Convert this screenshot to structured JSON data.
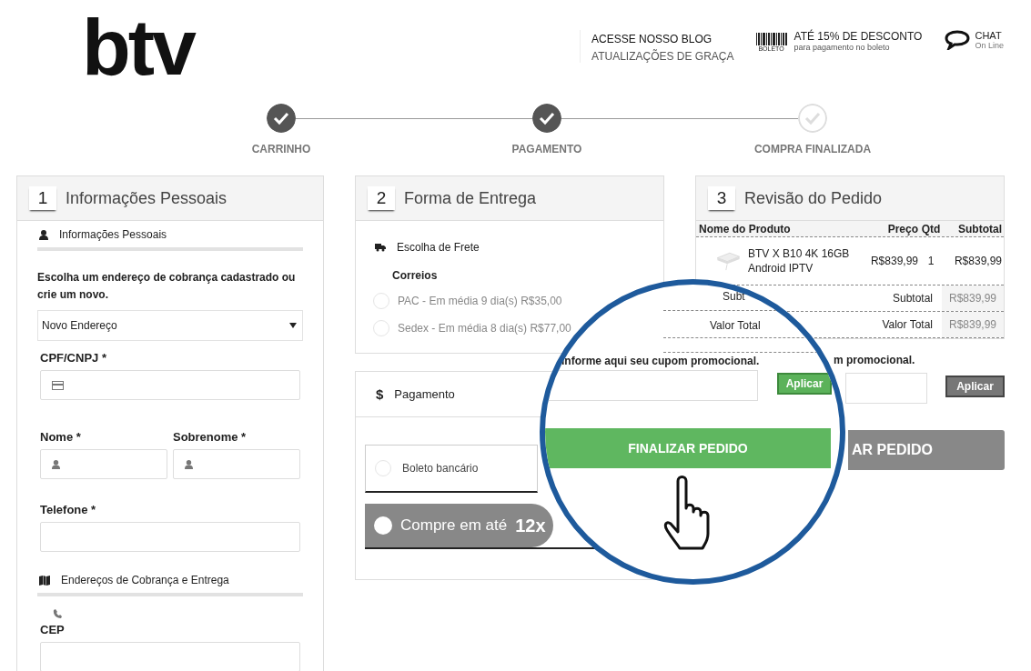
{
  "header": {
    "logo": "btv",
    "blog": {
      "line1": "ACESSE NOSSO BLOG",
      "line2": "ATUALIZAÇÕES DE GRAÇA"
    },
    "discount": {
      "barcode_caption": "BOLETO",
      "title": "ATÉ 15% DE DESCONTO",
      "subtitle": "para pagamento no boleto"
    },
    "chat": {
      "title": "CHAT",
      "subtitle": "On Line"
    }
  },
  "steps": [
    {
      "label": "CARRINHO",
      "done": true
    },
    {
      "label": "PAGAMENTO",
      "done": true
    },
    {
      "label": "COMPRA FINALIZADA",
      "done": false
    }
  ],
  "personal": {
    "number": "1",
    "title": "Informações Pessoais",
    "section": "Informações Pessoais",
    "prompt": "Escolha um endereço de cobrança cadastrado ou crie um novo.",
    "address_select": {
      "value": "Novo Endereço"
    },
    "cpf_label": "CPF/CNPJ *",
    "name_label": "Nome *",
    "surname_label": "Sobrenome *",
    "phone_label": "Telefone *",
    "address_section": "Endereços de Cobrança e Entrega",
    "cep_label": "CEP"
  },
  "delivery": {
    "number": "2",
    "title": "Forma de Entrega",
    "section": "Escolha de Frete",
    "carrier": "Correios",
    "options": [
      {
        "label": "PAC - Em média 9 dia(s) R$35,00",
        "selected": false
      },
      {
        "label": "Sedex - Em média 8 dia(s) R$77,00",
        "selected": false
      }
    ]
  },
  "payment": {
    "title": "Pagamento",
    "currency_symbol": "$",
    "options": [
      {
        "label": "Boleto bancário",
        "selected": false
      }
    ],
    "installments_banner": {
      "selected": false,
      "text": "Compre em até",
      "highlight": "12x"
    }
  },
  "review": {
    "number": "3",
    "title": "Revisão do Pedido",
    "columns": [
      "Nome do Produto",
      "Preço",
      "Qtd",
      "Subtotal"
    ],
    "items": [
      {
        "name": "BTV X B10 4K 16GB Android IPTV",
        "price": "R$839,99",
        "qty": "1",
        "subtotal": "R$839,99"
      }
    ],
    "totals": [
      {
        "label": "Subtotal",
        "value": "R$839,99"
      },
      {
        "label": "Valor Total",
        "value": "R$839,99"
      }
    ],
    "coupon_label_visible": "m promocional.",
    "apply_button": "Aplicar",
    "finish_button_visible": "AR PEDIDO"
  },
  "magnifier": {
    "rows": [
      "Subt",
      "Valor Total"
    ],
    "coupon_label": "Informe aqui seu cupom promocional.",
    "apply_button": "Aplicar",
    "finish_button": "FINALIZAR PEDIDO"
  }
}
